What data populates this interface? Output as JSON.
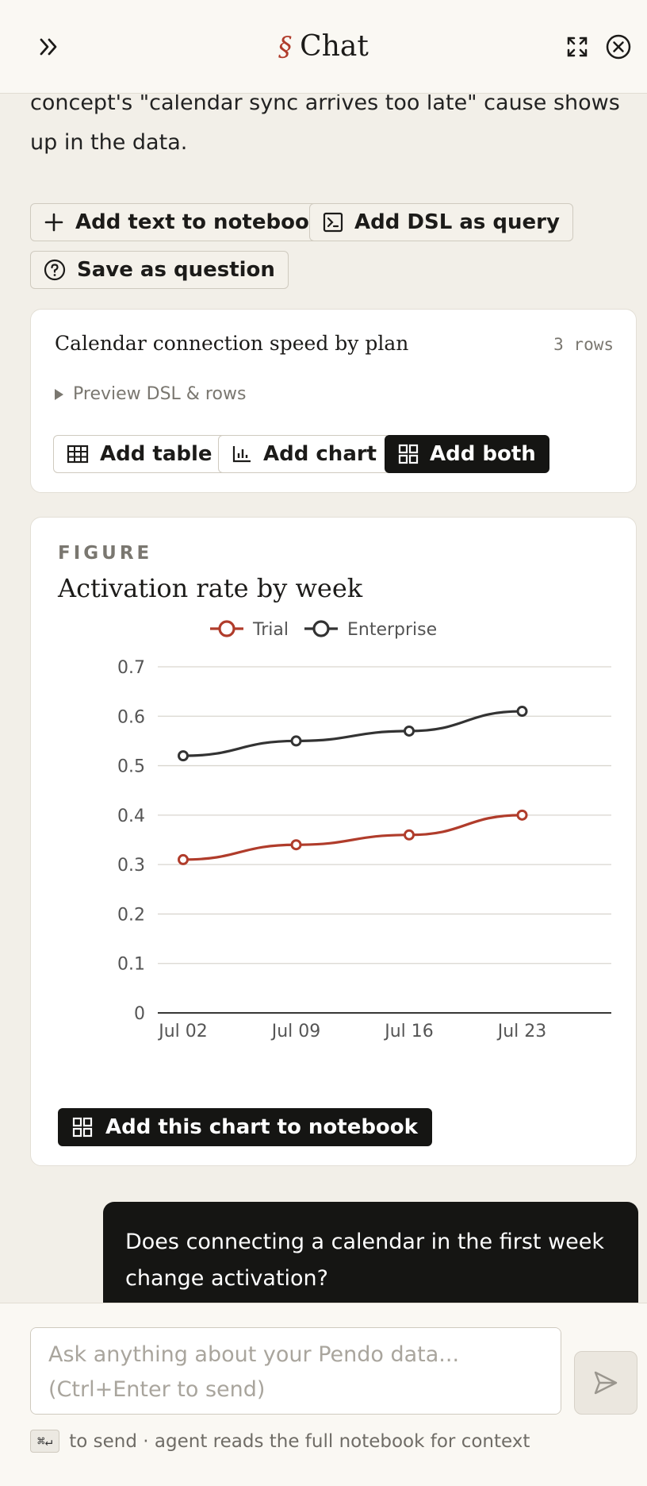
{
  "header": {
    "title": "Chat",
    "section_symbol": "§",
    "icons": [
      "chevrons-right-icon",
      "expand-icon",
      "close-circle-icon"
    ]
  },
  "assistant_message": {
    "text": "concept's \"calendar sync arrives too late\" cause shows up in the data."
  },
  "actions": {
    "add_text": "Add text to notebook",
    "add_dsl": "Add DSL as query",
    "save_question": "Save as question"
  },
  "query_card": {
    "title": "Calendar connection speed by plan",
    "rows": "3 rows",
    "preview": "Preview DSL & rows",
    "add_table": "Add table",
    "add_chart": "Add chart",
    "add_both": "Add both"
  },
  "figure_card": {
    "label": "FIGURE",
    "title": "Activation rate by week",
    "add_button": "Add this chart to notebook"
  },
  "chart_data": {
    "type": "line",
    "title": "Activation rate by week",
    "categories": [
      "Jul 02",
      "Jul 09",
      "Jul 16",
      "Jul 23"
    ],
    "series": [
      {
        "name": "Trial",
        "values": [
          0.31,
          0.34,
          0.36,
          0.4
        ],
        "color": "#b03c2b"
      },
      {
        "name": "Enterprise",
        "values": [
          0.52,
          0.55,
          0.57,
          0.61
        ],
        "color": "#333333"
      }
    ],
    "ylim": [
      0,
      0.7
    ],
    "yticks": [
      "0",
      "0.1",
      "0.2",
      "0.3",
      "0.4",
      "0.5",
      "0.6",
      "0.7"
    ],
    "grid": true,
    "legend": "top-center"
  },
  "user_message": {
    "text": "Does connecting a calendar in the first week change activation?"
  },
  "composer": {
    "placeholder": "Ask anything about your Pendo data... (Ctrl+Enter to send)",
    "kbd": "⌘↵",
    "hint": "to send · agent reads the full notebook for context"
  },
  "colors": {
    "accent": "#b03c2b",
    "dark": "#151513",
    "background": "#f2efe8"
  }
}
